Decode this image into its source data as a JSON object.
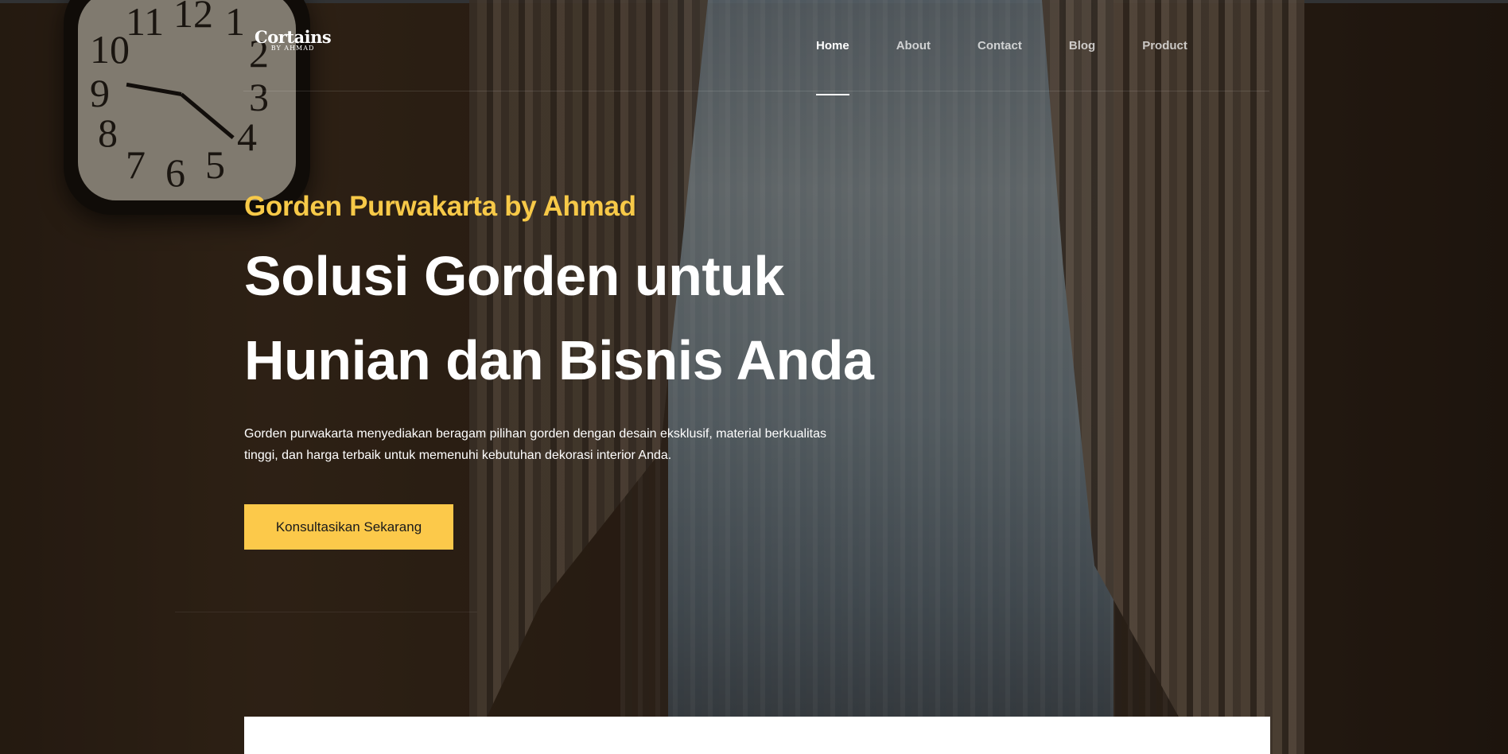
{
  "logo": {
    "brand": "Cortains",
    "sub": "BY AHMAD"
  },
  "nav": {
    "items": [
      {
        "label": "Home",
        "active": true
      },
      {
        "label": "About",
        "active": false
      },
      {
        "label": "Contact",
        "active": false
      },
      {
        "label": "Blog",
        "active": false
      },
      {
        "label": "Product",
        "active": false
      }
    ]
  },
  "hero": {
    "tagline": "Gorden Purwakarta by Ahmad",
    "headline_line1": "Solusi Gorden untuk",
    "headline_line2": "Hunian dan Bisnis Anda",
    "description": "Gorden purwakarta menyediakan beragam pilihan gorden dengan desain eksklusif, material berkualitas tinggi, dan harga terbaik untuk memenuhi kebutuhan dekorasi interior Anda.",
    "cta_label": "Konsultasikan Sekarang"
  },
  "colors": {
    "accent": "#fcc94a",
    "tagline": "#f7c948",
    "text": "#ffffff"
  },
  "background_image": "curtain-window-clock-photo"
}
